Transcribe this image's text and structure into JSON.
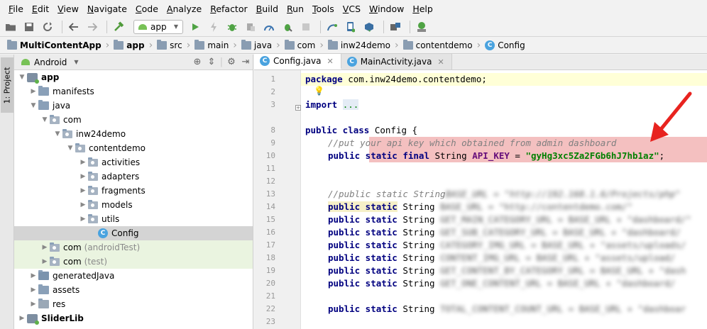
{
  "menu": [
    "File",
    "Edit",
    "View",
    "Navigate",
    "Code",
    "Analyze",
    "Refactor",
    "Build",
    "Run",
    "Tools",
    "VCS",
    "Window",
    "Help"
  ],
  "toolbar": {
    "run_config": "app"
  },
  "breadcrumb": [
    "MultiContentApp",
    "app",
    "src",
    "main",
    "java",
    "com",
    "inw24demo",
    "contentdemo",
    "Config"
  ],
  "sidebar": {
    "project_tab": "1: Project"
  },
  "project": {
    "view_label": "Android",
    "tree": {
      "app": "app",
      "manifests": "manifests",
      "java": "java",
      "com": "com",
      "inw24demo": "inw24demo",
      "contentdemo": "contentdemo",
      "activities": "activities",
      "adapters": "adapters",
      "fragments": "fragments",
      "models": "models",
      "utils": "utils",
      "config": "Config",
      "com_android_test": "com",
      "android_test_suffix": "(androidTest)",
      "com_test": "com",
      "test_suffix": "(test)",
      "generated_java": "generatedJava",
      "assets": "assets",
      "res": "res",
      "sliderlib": "SliderLib"
    }
  },
  "editor": {
    "tabs": [
      "Config.java",
      "MainActivity.java"
    ],
    "line_numbers": [
      "1",
      "2",
      "3",
      "8",
      "9",
      "10",
      "11",
      "12",
      "13",
      "14",
      "15",
      "16",
      "17",
      "18",
      "19",
      "20",
      "21",
      "22",
      "23"
    ],
    "code": {
      "l1_kw": "package",
      "l1_rest": " com.inw24demo.contentdemo;",
      "l3_kw": "import",
      "l3_fold": "...",
      "l8_kw": "public class",
      "l8_rest": " Config {",
      "l9_comment": "//put your api key which obtained from admin dashboard",
      "l10_kw": "public static final",
      "l10_type": " String ",
      "l10_field": "API_KEY",
      "l10_eq": " = ",
      "l10_value": "\"gyHg3xc5Za2FGb6hJ7hb1az\"",
      "l10_end": ";",
      "l13_comment": "//public static String",
      "l13_blur": " BASE_URL = \"http://192.168.1.6/Projects/php\"",
      "kw_public_static": "public static",
      "type_string": " String ",
      "l14_blur": "BASE_URL = \"http://contentdemo.com/\"",
      "l15_blur": "GET_MAIN_CATEGORY_URL = BASE_URL + \"dashboard/\"",
      "l16_blur": "GET_SUB_CATEGORY_URL = BASE_URL + \"dashboard/",
      "l17_blur": "CATEGORY_IMG_URL = BASE_URL + \"assets/uploads/",
      "l18_blur": "CONTENT_IMG_URL = BASE_URL + \"assets/upload/",
      "l19_blur": "GET_CONTENT_BY_CATEGORY_URL = BASE_URL + \"dash",
      "l20_blur": "GET_ONE_CONTENT_URL = BASE_URL + \"dashboard/",
      "l22_blur": "TOTAL_CONTENT_COUNT_URL = BASE_URL + \"dashboar"
    }
  }
}
